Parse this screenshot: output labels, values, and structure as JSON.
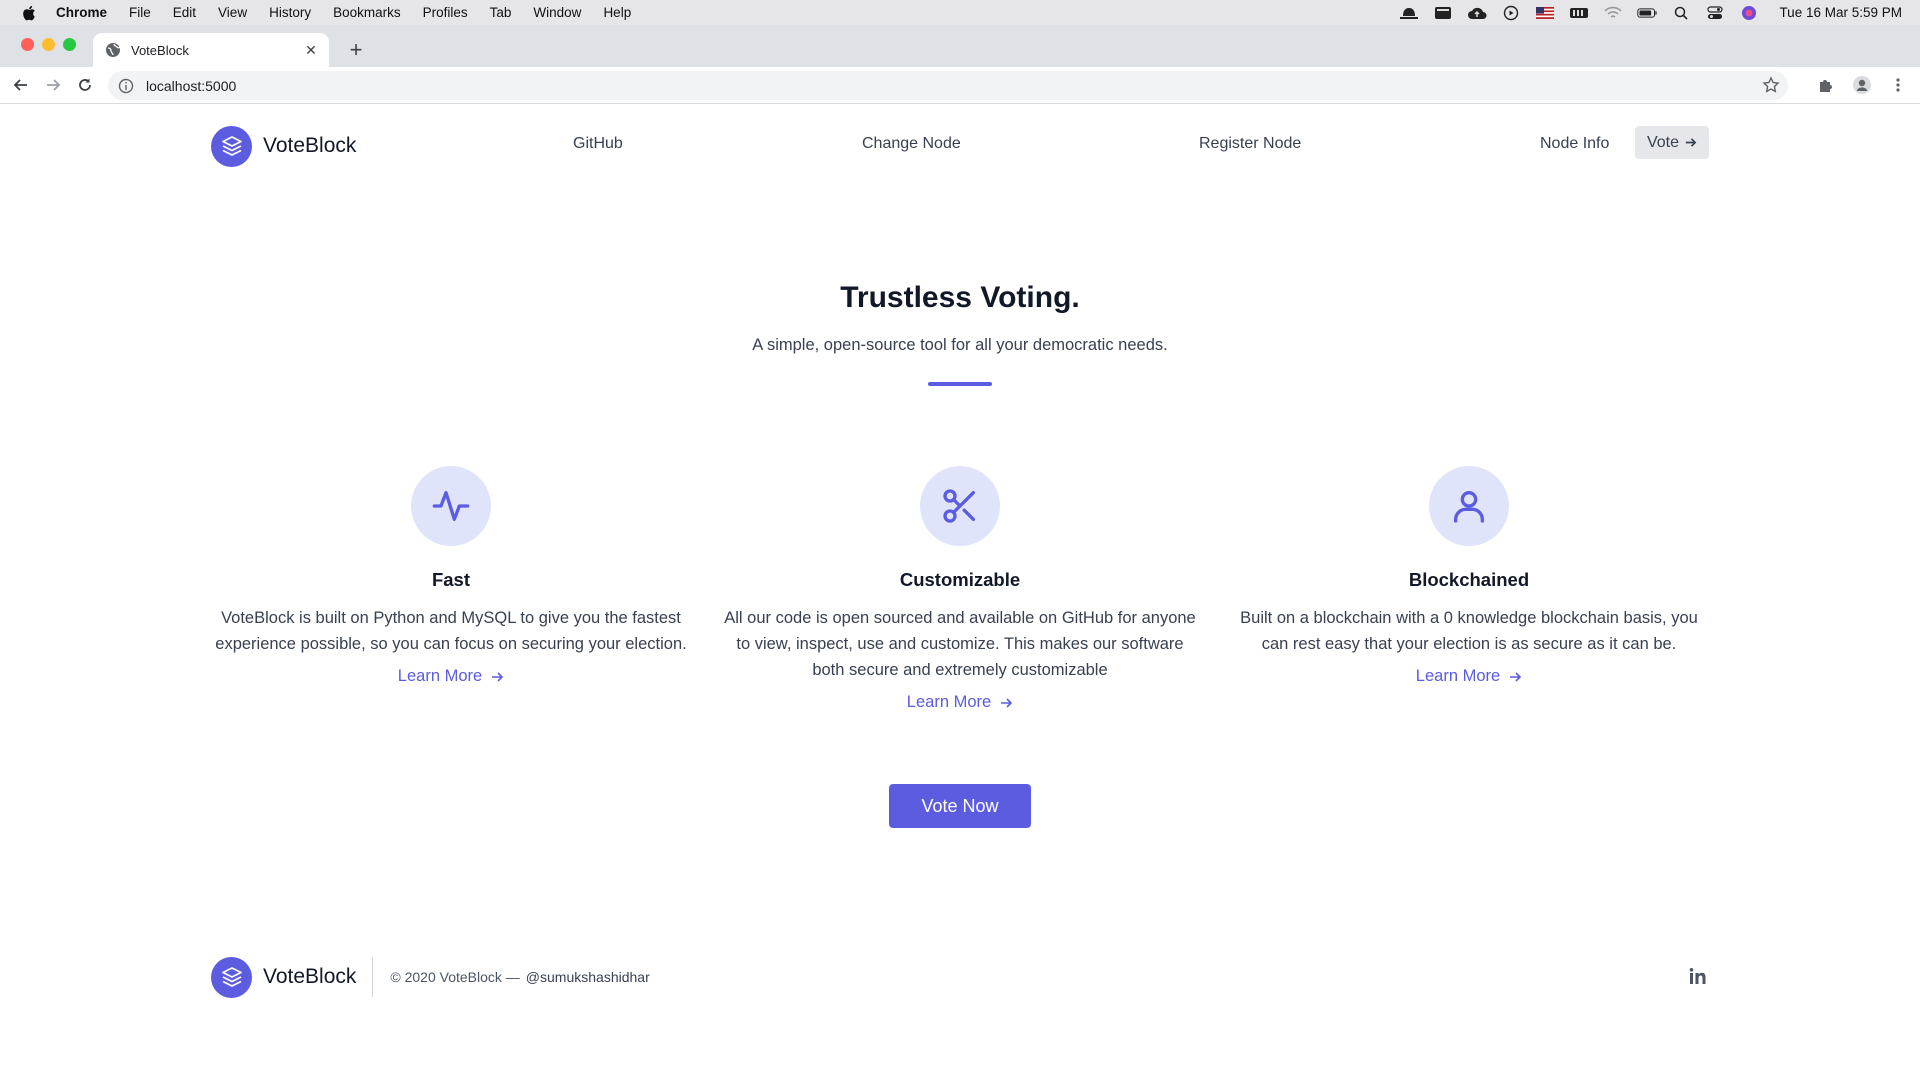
{
  "menubar": {
    "app": "Chrome",
    "items": [
      "File",
      "Edit",
      "View",
      "History",
      "Bookmarks",
      "Profiles",
      "Tab",
      "Window",
      "Help"
    ],
    "clock": "Tue 16 Mar  5:59 PM"
  },
  "browser": {
    "tab_title": "VoteBlock",
    "url": "localhost:5000"
  },
  "header": {
    "brand": "VoteBlock",
    "nav": [
      "GitHub",
      "Change Node",
      "Register Node",
      "Node Info"
    ],
    "vote_label": "Vote"
  },
  "hero": {
    "title": "Trustless Voting.",
    "subtitle": "A simple, open-source tool for all your democratic needs."
  },
  "features": [
    {
      "title": "Fast",
      "icon": "activity-icon",
      "description": "VoteBlock is built on Python and MySQL to give you the fastest experience possible, so you can focus on securing your election.",
      "link": "Learn More"
    },
    {
      "title": "Customizable",
      "icon": "scissors-icon",
      "description": "All our code is open sourced and available on GitHub for anyone to view, inspect, use and customize. This makes our software both secure and extremely customizable",
      "link": "Learn More"
    },
    {
      "title": "Blockchained",
      "icon": "user-icon",
      "description": "Built on a blockchain with a 0 knowledge blockchain basis, you can rest easy that your election is as secure as it can be.",
      "link": "Learn More"
    }
  ],
  "cta": {
    "label": "Vote Now"
  },
  "footer": {
    "brand": "VoteBlock",
    "copyright": "© 2020 VoteBlock —",
    "handle": "@sumukshashidhar"
  },
  "colors": {
    "accent": "#5b5ce0",
    "icon_bg": "#e0e4fb",
    "vote_button_bg": "#e5e7eb"
  }
}
